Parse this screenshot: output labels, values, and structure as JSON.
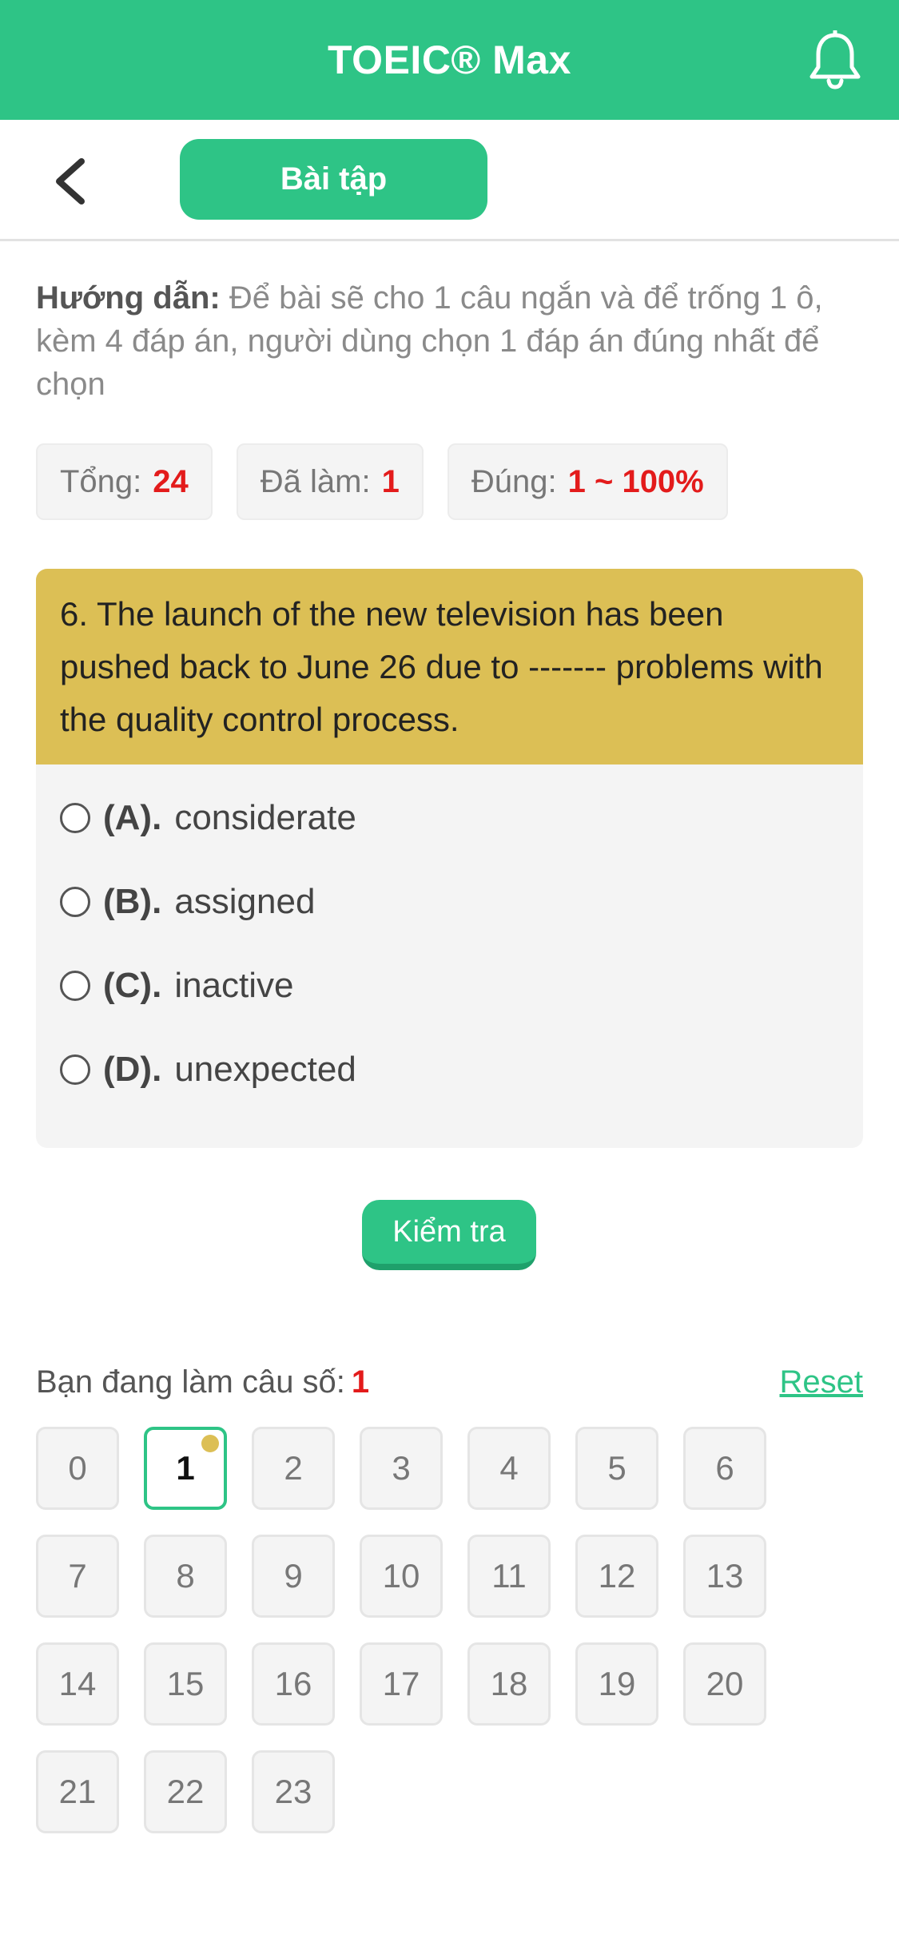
{
  "header": {
    "title": "TOEIC® Max",
    "bell_icon": "bell-icon"
  },
  "toolbar": {
    "back_icon": "chevron-left-icon",
    "tab_label": "Bài tập"
  },
  "instruction": {
    "label": "Hướng dẫn:",
    "text": "Để bài sẽ cho 1 câu ngắn và để trống 1 ô, kèm 4 đáp án, người dùng chọn 1 đáp án đúng nhất để chọn"
  },
  "stats": {
    "total_label": "Tổng:",
    "total_value": "24",
    "done_label": "Đã làm:",
    "done_value": "1",
    "correct_label": "Đúng:",
    "correct_value": "1 ~ 100%"
  },
  "question": {
    "text": "6. The launch of the new television has been pushed back to June 26 due to ------- problems with the quality control process.",
    "options": [
      {
        "key": "(A).",
        "text": "considerate"
      },
      {
        "key": "(B).",
        "text": "assigned"
      },
      {
        "key": "(C).",
        "text": "inactive"
      },
      {
        "key": "(D).",
        "text": "unexpected"
      }
    ]
  },
  "check_button": "Kiểm tra",
  "progress": {
    "label": "Bạn đang làm câu số:",
    "current": "1",
    "reset_label": "Reset"
  },
  "numbers": [
    "0",
    "1",
    "2",
    "3",
    "4",
    "5",
    "6",
    "7",
    "8",
    "9",
    "10",
    "11",
    "12",
    "13",
    "14",
    "15",
    "16",
    "17",
    "18",
    "19",
    "20",
    "21",
    "22",
    "23"
  ],
  "colors": {
    "primary": "#2ec486",
    "question_header": "#dcbf55",
    "highlight": "#e31b1b"
  }
}
